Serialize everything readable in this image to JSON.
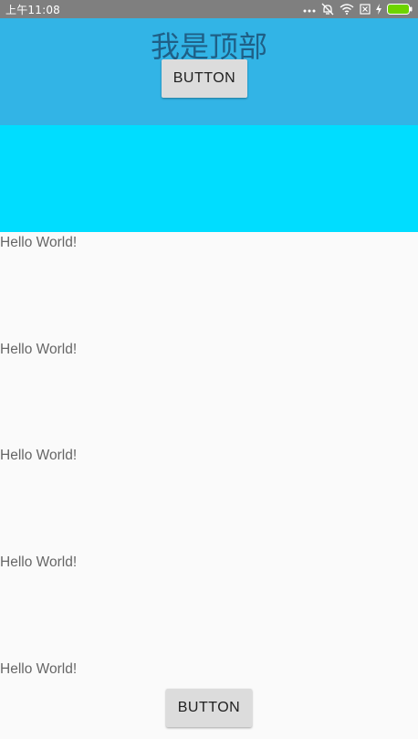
{
  "status_bar": {
    "time": "上午11:08",
    "icons": [
      "more-dots-icon",
      "alarm-off-icon",
      "wifi-icon",
      "sim-x-icon",
      "charging-icon",
      "battery-icon"
    ],
    "battery_color": "#6dd400"
  },
  "header": {
    "title": "我是顶部",
    "button_label": "BUTTON",
    "background": "#32b4e6"
  },
  "band": {
    "background": "#00ddff"
  },
  "content": {
    "items": [
      "Hello World!",
      "Hello World!",
      "Hello World!",
      "Hello World!",
      "Hello World!"
    ]
  },
  "footer": {
    "button_label": "BUTTON"
  }
}
